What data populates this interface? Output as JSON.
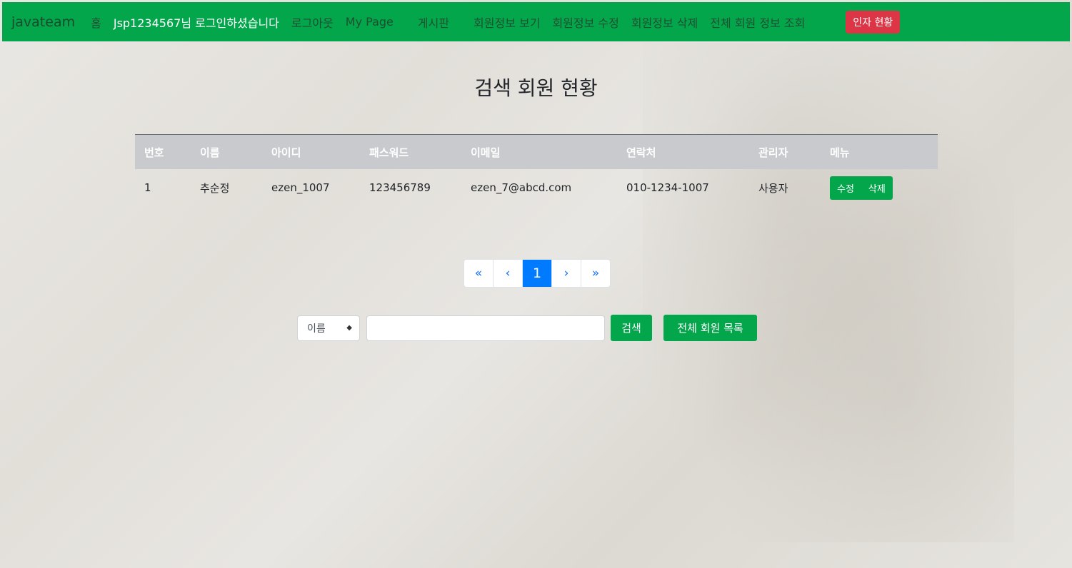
{
  "navbar": {
    "brand": "javateam",
    "home": "홈",
    "user_greeting": "Jsp1234567님 로그인하셨습니다",
    "logout": "로그아웃",
    "mypage": "My Page",
    "board": "게시판",
    "member_view": "회원정보 보기",
    "member_edit": "회원정보 수정",
    "member_delete": "회원정보 삭제",
    "all_members": "전체 회원 정보 조회",
    "stats_button": "인자 현황"
  },
  "page_title": "검색 회원 현황",
  "table": {
    "headers": [
      "번호",
      "이름",
      "아이디",
      "패스워드",
      "이메일",
      "연락처",
      "관리자",
      "메뉴"
    ],
    "rows": [
      {
        "no": "1",
        "name": "추순정",
        "id": "ezen_1007",
        "password": "123456789",
        "email": "ezen_7@abcd.com",
        "phone": "010-1234-1007",
        "role": "사용자",
        "edit_label": "수정",
        "delete_label": "삭제"
      }
    ]
  },
  "pagination": {
    "first": "«",
    "prev": "‹",
    "current": "1",
    "next": "›",
    "last": "»"
  },
  "search": {
    "select_value": "이름",
    "input_value": "",
    "search_button": "검색",
    "all_list_button": "전체 회원 목록"
  },
  "colors": {
    "primary_green": "#03a64b",
    "danger_red": "#dc3545",
    "page_active_blue": "#007bff"
  }
}
